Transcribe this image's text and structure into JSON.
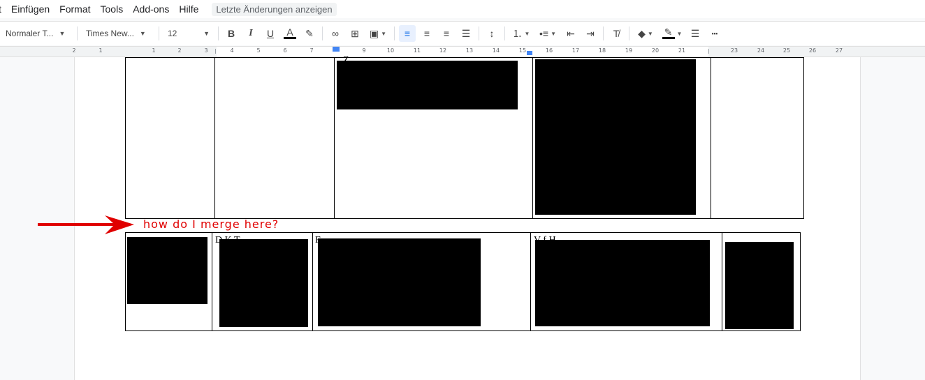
{
  "menu": {
    "items": [
      "t",
      "Einfügen",
      "Format",
      "Tools",
      "Add-ons",
      "Hilfe"
    ],
    "last_changes": "Letzte Änderungen anzeigen"
  },
  "toolbar": {
    "style": "Normaler T...",
    "font": "Times New...",
    "size": "12",
    "icons": [
      "bold-icon",
      "italic-icon",
      "underline-icon",
      "text-color-icon",
      "highlight-icon",
      "link-icon",
      "add-comment-icon",
      "insert-image-icon",
      "align-left-icon",
      "align-center-icon",
      "align-right-icon",
      "justify-icon",
      "line-spacing-icon",
      "numbered-list-icon",
      "bulleted-list-icon",
      "decrease-indent-icon",
      "increase-indent-icon",
      "clear-formatting-icon",
      "fill-color-icon",
      "border-color-icon",
      "border-width-icon",
      "border-dash-icon"
    ]
  },
  "ruler": {
    "left_labels": [
      "2",
      "1",
      "1",
      "2",
      "3"
    ],
    "right_labels": [
      "4",
      "5",
      "6",
      "7",
      "8",
      "9",
      "10",
      "11",
      "12",
      "13",
      "14",
      "15",
      "16",
      "17",
      "18",
      "19",
      "20",
      "21",
      "23",
      "24",
      "25",
      "26",
      "27"
    ]
  },
  "document": {
    "annotation": "how do I merge here?",
    "fragments": {
      "row1_col3_top": "Z                                    ",
      "row2_col2": "D   K   T",
      "row2_col3": "F",
      "row2_col4": "V                    f  H   "
    }
  },
  "colors": {
    "annotation": "#e00000",
    "accent": "#1a73e8"
  }
}
